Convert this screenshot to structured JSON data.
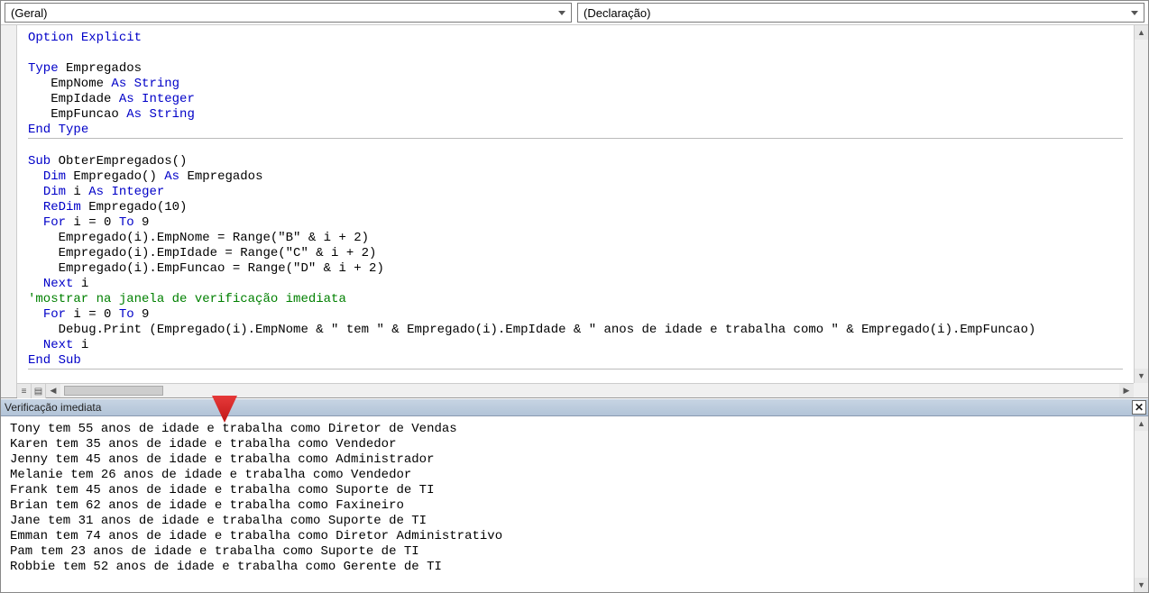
{
  "dropdowns": {
    "object": "(Geral)",
    "procedure": "(Declaração)"
  },
  "code": {
    "section1": [
      {
        "t": "Option Explicit",
        "kw": [
          "Option",
          "Explicit"
        ]
      }
    ],
    "section2": [
      {
        "t": "Type Empregados",
        "kw": [
          "Type"
        ]
      },
      {
        "t": "   EmpNome As String",
        "kw": [
          "As",
          "String"
        ]
      },
      {
        "t": "   EmpIdade As Integer",
        "kw": [
          "As",
          "Integer"
        ]
      },
      {
        "t": "   EmpFuncao As String",
        "kw": [
          "As",
          "String"
        ]
      },
      {
        "t": "End Type",
        "kw": [
          "End",
          "Type"
        ]
      }
    ],
    "section3": [
      {
        "t": "",
        "kw": []
      },
      {
        "t": "Sub ObterEmpregados()",
        "kw": [
          "Sub"
        ]
      },
      {
        "t": "  Dim Empregado() As Empregados",
        "kw": [
          "Dim",
          "As"
        ]
      },
      {
        "t": "  Dim i As Integer",
        "kw": [
          "Dim",
          "As",
          "Integer"
        ]
      },
      {
        "t": "  ReDim Empregado(10)",
        "kw": [
          "ReDim"
        ]
      },
      {
        "t": "  For i = 0 To 9",
        "kw": [
          "For",
          "To"
        ]
      },
      {
        "t": "    Empregado(i).EmpNome = Range(\"B\" & i + 2)",
        "kw": []
      },
      {
        "t": "    Empregado(i).EmpIdade = Range(\"C\" & i + 2)",
        "kw": []
      },
      {
        "t": "    Empregado(i).EmpFuncao = Range(\"D\" & i + 2)",
        "kw": []
      },
      {
        "t": "  Next i",
        "kw": [
          "Next"
        ]
      },
      {
        "t": "'mostrar na janela de verificação imediata",
        "cm": true
      },
      {
        "t": "  For i = 0 To 9",
        "kw": [
          "For",
          "To"
        ]
      },
      {
        "t": "    Debug.Print (Empregado(i).EmpNome & \" tem \" & Empregado(i).EmpIdade & \" anos de idade e trabalha como \" & Empregado(i).EmpFuncao)",
        "kw": []
      },
      {
        "t": "  Next i",
        "kw": [
          "Next"
        ]
      },
      {
        "t": "End Sub",
        "kw": [
          "End",
          "Sub"
        ]
      }
    ]
  },
  "immediate": {
    "title": "Verificação imediata",
    "lines": [
      "Tony tem 55 anos de idade e trabalha como Diretor de Vendas",
      "Karen tem 35 anos de idade e trabalha como Vendedor",
      "Jenny tem 45 anos de idade e trabalha como Administrador",
      "Melanie tem 26 anos de idade e trabalha como Vendedor",
      "Frank tem 45 anos de idade e trabalha como Suporte de TI",
      "Brian tem 62 anos de idade e trabalha como Faxineiro",
      "Jane tem 31 anos de idade e trabalha como Suporte de TI",
      "Emman tem 74 anos de idade e trabalha como Diretor Administrativo",
      "Pam tem 23 anos de idade e trabalha como Suporte de TI",
      "Robbie tem 52 anos de idade e trabalha como Gerente de TI"
    ]
  },
  "arrow_color": "#e63939"
}
